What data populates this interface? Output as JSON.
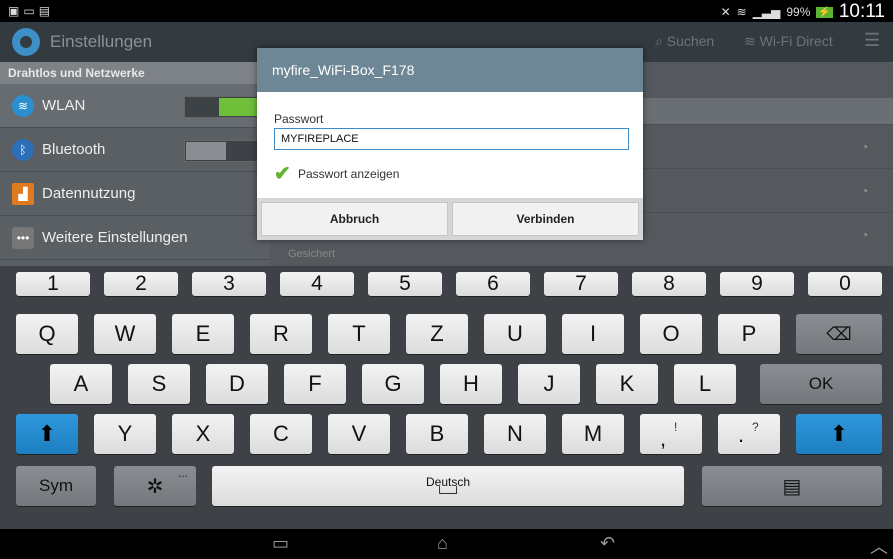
{
  "status_bar": {
    "left_icons": [
      "image-icon",
      "keyboard-icon",
      "clipboard-icon"
    ],
    "battery": "99%",
    "time": "10:11"
  },
  "action_bar": {
    "title": "Einstellungen",
    "search_label": "Suchen",
    "wifi_direct_label": "Wi-Fi Direct"
  },
  "left_list": {
    "section_header": "Drahtlos und Netzwerke",
    "items": [
      {
        "label": "WLAN",
        "icon": "wifi-icon",
        "toggle": "on"
      },
      {
        "label": "Bluetooth",
        "icon": "bluetooth-icon",
        "toggle": "off"
      },
      {
        "label": "Datennutzung",
        "icon": "data-usage-icon"
      },
      {
        "label": "Weitere Einstellungen",
        "icon": "more-icon"
      }
    ]
  },
  "right_list": {
    "last_network_status": "Gesichert"
  },
  "dialog": {
    "title": "myfire_WiFi-Box_F178",
    "password_label": "Passwort",
    "password_value": "MYFIREPLACE",
    "show_password_label": "Passwort anzeigen",
    "show_password_checked": true,
    "cancel_label": "Abbruch",
    "connect_label": "Verbinden"
  },
  "keyboard": {
    "number_row": [
      "1",
      "2",
      "3",
      "4",
      "5",
      "6",
      "7",
      "8",
      "9",
      "0"
    ],
    "row1": [
      "Q",
      "W",
      "E",
      "R",
      "T",
      "Z",
      "U",
      "I",
      "O",
      "P"
    ],
    "row2": [
      "A",
      "S",
      "D",
      "F",
      "G",
      "H",
      "J",
      "K",
      "L"
    ],
    "row3": [
      "Y",
      "X",
      "C",
      "V",
      "B",
      "N",
      "M"
    ],
    "comma_key": ",",
    "comma_sub": "!",
    "period_key": ".",
    "period_sub": "?",
    "ok_label": "OK",
    "sym_label": "Sym",
    "space_label": "Deutsch",
    "settings_dots": "..."
  },
  "colors": {
    "accent_blue": "#1d7fc1",
    "dialog_header": "#6e8797",
    "check_green": "#62b32f"
  }
}
